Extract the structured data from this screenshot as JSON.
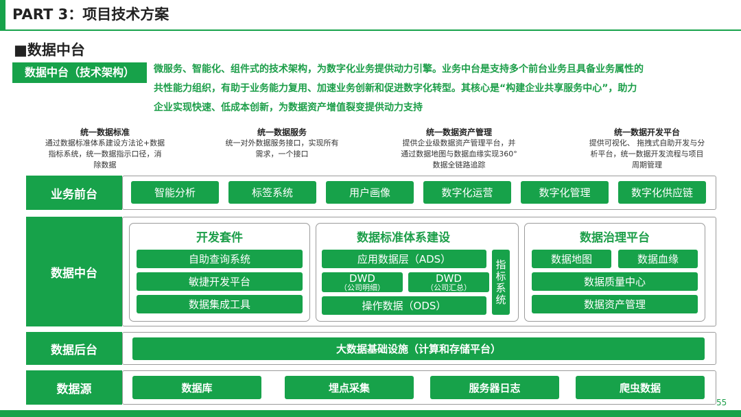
{
  "header": {
    "title": "PART 3：项目技术方案"
  },
  "section": {
    "title": "■数据中台",
    "tag": "数据中台（技术架构）"
  },
  "description": {
    "line1": "微服务、智能化、组件式的技术架构，为数字化业务提供动力引擎。业务中台是支持多个前台业务且具备业务属性的",
    "line2": "共性能力组织，有助于业务能力复用、加速业务创新和促进数字化转型。其核心是“构建企业共享服务中心”，助力",
    "line3": "企业实现快速、低成本创新，为数据资产增值裂变提供动力支持"
  },
  "features": [
    {
      "title": "统一数据标准",
      "l1": "通过数据标准体系建设方法论+数据",
      "l2": "指标系统，统一数据指示口径，消",
      "l3": "除数据"
    },
    {
      "title": "统一数据服务",
      "l1": "统一对外数据服务接口，实现所有",
      "l2": "需求，一个接口",
      "l3": ""
    },
    {
      "title": "统一数据资产管理",
      "l1": "提供企业级数据资产管理平台，并",
      "l2": "通过数据地图与数据血缘实现360°",
      "l3": "数据全链路追踪"
    },
    {
      "title": "统一数据开发平台",
      "l1": "提供可视化、 拖拽式自助开发与分",
      "l2": "析平台，统一数据开发流程与项目",
      "l3": "周期管理"
    }
  ],
  "layers": {
    "front": {
      "label": "业务前台",
      "items": [
        "智能分析",
        "标签系统",
        "用户画像",
        "数字化运营",
        "数字化管理",
        "数字化供应链"
      ]
    },
    "middle": {
      "label": "数据中台",
      "dev_suite": {
        "title": "开发套件",
        "items": [
          "自助查询系统",
          "敏捷开发平台",
          "数据集成工具"
        ]
      },
      "standards": {
        "title": "数据标准体系建设",
        "ads": "应用数据层（ADS）",
        "dwd1": {
          "name": "DWD",
          "sub": "（公司明细）"
        },
        "dwd2": {
          "name": "DWD",
          "sub": "（公司汇总）"
        },
        "ods": "操作数据（ODS）",
        "indicator": [
          "指",
          "标",
          "系",
          "统"
        ]
      },
      "governance": {
        "title": "数据治理平台",
        "map": "数据地图",
        "lineage": "数据血缘",
        "quality": "数据质量中心",
        "asset": "数据资产管理"
      }
    },
    "back": {
      "label": "数据后台",
      "item": "大数据基础设施（计算和存储平台）"
    },
    "source": {
      "label": "数据源",
      "items": [
        "数据库",
        "埋点采集",
        "服务器日志",
        "爬虫数据"
      ]
    }
  },
  "page_number": "55",
  "colors": {
    "accent": "#17a24a",
    "accent_text": "#1c9e49"
  }
}
